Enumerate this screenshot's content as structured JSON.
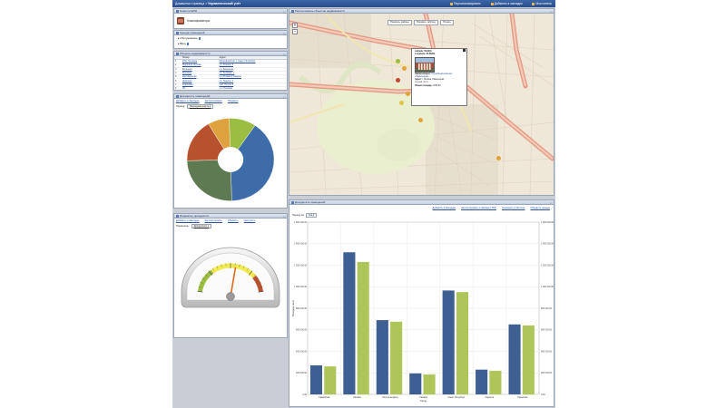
{
  "topbar": {
    "breadcrumb": "Домашняя страница",
    "breadcrumb_sep": " > ",
    "current": "Управленческий учёт",
    "links": [
      "Персонализировать",
      "Добавить в закладки",
      "Моя панель"
    ]
  },
  "news_panel": {
    "title": "Новости ЕРШ",
    "entity": "Классификаторы"
  },
  "info_panel": {
    "title": "Аренда помещений",
    "rows": [
      "Обслуживание",
      "Ввод"
    ]
  },
  "list_panel": {
    "title": "Объекты недвижимости",
    "columns": [
      "Номер",
      "Адрес"
    ],
    "rows": [
      [
        "1",
        "КНС Пушкина",
        "Московский пр-т, Санкт-Петербург"
      ],
      [
        "2",
        "Маршала Жукова",
        "ул. Ленина, 6"
      ],
      [
        "3",
        "Большая",
        "пр. Бакунина"
      ],
      [
        "4",
        "Морская",
        "пр. Зелёная, 1"
      ],
      [
        "5",
        "Центральная",
        "ул. Южная (Главная)"
      ],
      [
        "6",
        "Широкая",
        "пр. Ленина, 1"
      ],
      [
        "7",
        "Ковшовая",
        "наб. Петра, 8"
      ],
      [
        "8",
        "Ял",
        "ул. Пушкина"
      ]
    ]
  },
  "pie_panel": {
    "title": "Доходность помещений",
    "links": [
      "Добавить в Закладки",
      "Экспортировать",
      "Обновить"
    ],
    "select_label": "Период:",
    "select_value": "Последние шесть"
  },
  "gauge_panel": {
    "title": "Индикатор доходности",
    "links": [
      "Добавить в Закладки",
      "Экспортировать",
      "Обновить",
      "Настроить"
    ],
    "select_label": "Показатель:",
    "select_value": "Доход всего",
    "gauge_value": 0.56
  },
  "map_panel": {
    "title": "Расположение объектов недвижимости",
    "tabs": [
      "Показать районы",
      "Показать таблицу",
      "Печать"
    ],
    "popup": {
      "lat": "Latitude: 59.9091",
      "lng": "Longitude: 30.34902",
      "name_label": "Наименование:",
      "name": "Служебный комплекс",
      "name2": "«Павелецкий»",
      "addr_label": "Адрес:",
      "addr": "г. Москва, Павелецкая",
      "addr2": "пл.д.1А, стр.1",
      "area_label": "Общая площадь:",
      "area": "2256,00"
    }
  },
  "chart_panel": {
    "title": "Доходность помещений",
    "links": [
      "Добавить в Закладки",
      "Экспортировать в формате PDF",
      "Сохранить в Экспорт",
      "Обновить данные"
    ],
    "select_label": "Период за:",
    "select_value": "Год"
  },
  "chart_data": [
    {
      "type": "pie",
      "values": [
        40,
        25,
        17,
        8,
        10
      ],
      "colors": [
        "#3e6ca8",
        "#5d7a52",
        "#b8522e",
        "#dda23e",
        "#9bbd42"
      ],
      "hole": true
    },
    {
      "type": "bar",
      "categories": [
        "Самарская",
        "Москва",
        "Ростов-на-Дону",
        "Самара",
        "Санкт-Петербург",
        "Саратов",
        "Уфимская"
      ],
      "series": [
        {
          "values": [
            270000,
            1320000,
            690000,
            195000,
            965000,
            230000,
            650000
          ],
          "color": "#3e5f92"
        },
        {
          "values": [
            260000,
            1230000,
            675000,
            185000,
            950000,
            220000,
            640000
          ],
          "color": "#aec55a"
        }
      ],
      "ylim": [
        0,
        1600000
      ],
      "yticks": [
        "0,00",
        "200 000,00",
        "400 000,00",
        "600 000,00",
        "800 000,00",
        "1 000 000,00",
        "1 200 000,00",
        "1 400 000,00",
        "1 600 000,00"
      ],
      "ylabel": "Площадь, кв.м.",
      "xlabel": "Город"
    }
  ]
}
